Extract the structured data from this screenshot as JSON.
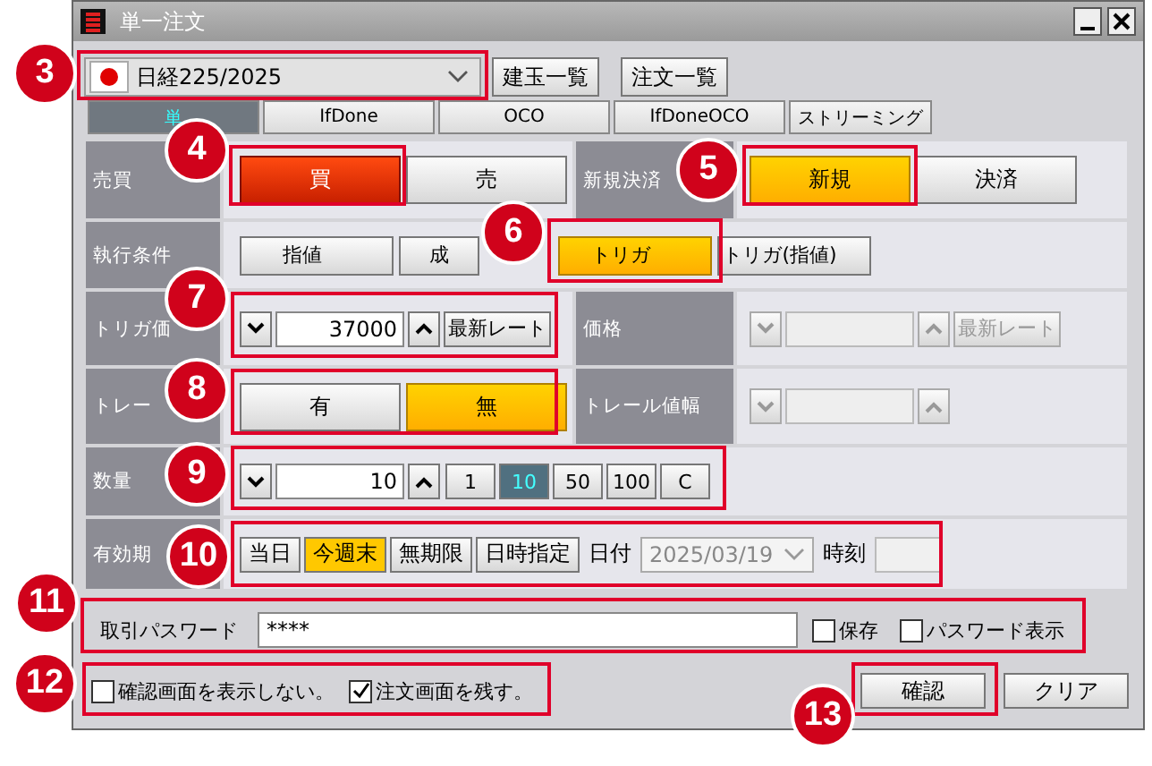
{
  "window": {
    "title": "単一注文"
  },
  "instrument": {
    "value": "日経225/2025"
  },
  "top_buttons": [
    "建玉一覧",
    "注文一覧"
  ],
  "tabs": [
    {
      "label": "単",
      "selected": true
    },
    {
      "label": "IfDone",
      "selected": false
    },
    {
      "label": "OCO",
      "selected": false
    },
    {
      "label": "IfDoneOCO",
      "selected": false
    },
    {
      "label": "ストリーミング",
      "selected": false
    }
  ],
  "side": {
    "label": "売買",
    "options": [
      {
        "label": "買",
        "kind": "buy",
        "selected": true
      },
      {
        "label": "売",
        "kind": "sell",
        "selected": false
      }
    ]
  },
  "open_close": {
    "label": "新規決済",
    "options": [
      {
        "label": "新規",
        "selected": true
      },
      {
        "label": "決済",
        "selected": false
      }
    ]
  },
  "condition": {
    "label": "執行条件",
    "options": [
      {
        "label": "指値",
        "selected": false
      },
      {
        "label": "成",
        "selected": false
      },
      {
        "label": "トリガ",
        "selected": true
      },
      {
        "label": "トリガ(指値)",
        "selected": false
      }
    ]
  },
  "trigger_price": {
    "label": "トリガ価",
    "value": "37000",
    "rate_button": "最新レート"
  },
  "price": {
    "label": "価格",
    "disabled": true,
    "rate_button": "最新レート"
  },
  "trail": {
    "label": "トレー",
    "options": [
      {
        "label": "有",
        "selected": false
      },
      {
        "label": "無",
        "selected": true
      }
    ]
  },
  "trail_width": {
    "label": "トレール値幅",
    "disabled": true
  },
  "quantity": {
    "label": "数量",
    "value": "10",
    "presets": [
      {
        "label": "1",
        "selected": false
      },
      {
        "label": "10",
        "selected": true
      },
      {
        "label": "50",
        "selected": false
      },
      {
        "label": "100",
        "selected": false
      },
      {
        "label": "C",
        "selected": false
      }
    ]
  },
  "validity": {
    "label": "有効期",
    "options": [
      {
        "label": "当日",
        "selected": false
      },
      {
        "label": "今週末",
        "selected": true
      },
      {
        "label": "無期限",
        "selected": false
      },
      {
        "label": "日時指定",
        "selected": false
      }
    ],
    "date_label": "日付",
    "date": "2025/03/19",
    "time_label": "時刻"
  },
  "password": {
    "label": "取引パスワード",
    "value": "****",
    "options": [
      {
        "label": "保存",
        "checked": false
      },
      {
        "label": "パスワード表示",
        "checked": false
      }
    ]
  },
  "footer_options": [
    {
      "label": "確認画面を表示しない。",
      "checked": false
    },
    {
      "label": "注文画面を残す。",
      "checked": true
    }
  ],
  "buttons": [
    "確認",
    "クリア"
  ],
  "callouts": [
    "3",
    "4",
    "5",
    "6",
    "7",
    "8",
    "9",
    "10",
    "11",
    "12",
    "13"
  ]
}
